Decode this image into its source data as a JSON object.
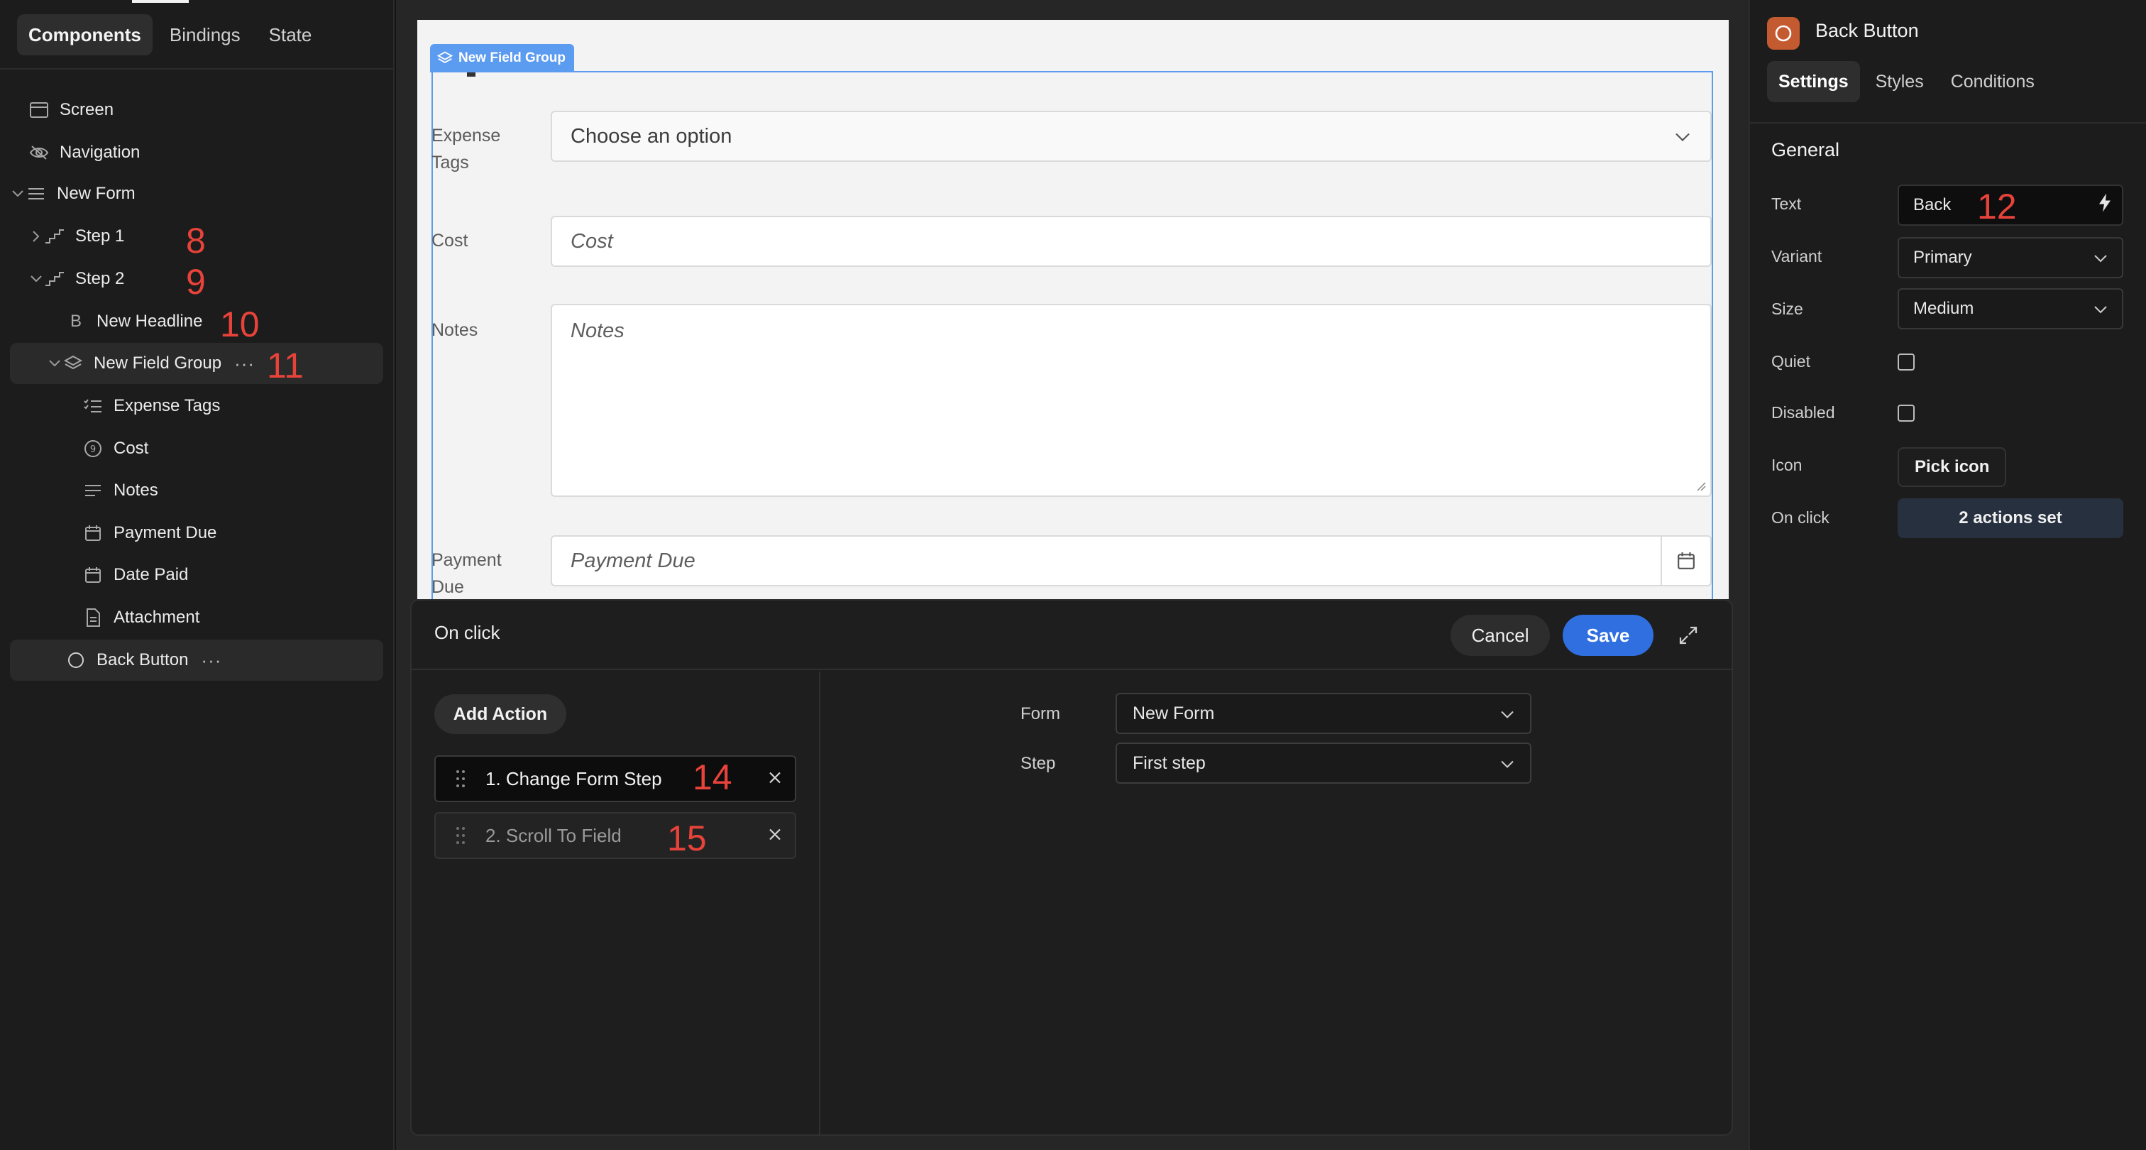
{
  "left_panel": {
    "tabs": [
      "Components",
      "Bindings",
      "State"
    ],
    "tree": {
      "screen": "Screen",
      "navigation": "Navigation",
      "new_form": "New Form",
      "step1": "Step 1",
      "step2": "Step 2",
      "new_headline": "New Headline",
      "new_field_group": "New Field Group",
      "expense_tags": "Expense Tags",
      "cost": "Cost",
      "notes": "Notes",
      "payment_due": "Payment Due",
      "date_paid": "Date Paid",
      "attachment": "Attachment",
      "back_button": "Back Button",
      "more": "···"
    }
  },
  "annotations": {
    "a8": "8",
    "a9": "9",
    "a10": "10",
    "a11": "11",
    "a12": "12",
    "a14": "14",
    "a15": "15"
  },
  "preview": {
    "group_tag": "New Field Group",
    "fields": {
      "expense_tags_label": "Expense Tags",
      "expense_tags_value": "Choose an option",
      "cost_label": "Cost",
      "cost_placeholder": "Cost",
      "notes_label": "Notes",
      "notes_placeholder": "Notes",
      "payment_due_label": "Payment Due",
      "payment_due_placeholder": "Payment Due"
    }
  },
  "modal": {
    "title": "On click",
    "cancel": "Cancel",
    "save": "Save",
    "add_action": "Add Action",
    "actions": [
      "1. Change Form Step",
      "2. Scroll To Field"
    ],
    "params": {
      "form_label": "Form",
      "form_value": "New Form",
      "step_label": "Step",
      "step_value": "First step"
    }
  },
  "right_panel": {
    "title": "Back Button",
    "tabs": [
      "Settings",
      "Styles",
      "Conditions"
    ],
    "section": "General",
    "text_label": "Text",
    "text_value": "Back",
    "variant_label": "Variant",
    "variant_value": "Primary",
    "size_label": "Size",
    "size_value": "Medium",
    "quiet_label": "Quiet",
    "disabled_label": "Disabled",
    "icon_label": "Icon",
    "icon_button": "Pick icon",
    "onclick_label": "On click",
    "onclick_value": "2 actions set"
  },
  "colors": {
    "accent": "#2f6fe0",
    "selection": "#5b9bf0",
    "annotation": "#e8433a",
    "component_icon": "#c45a30"
  }
}
